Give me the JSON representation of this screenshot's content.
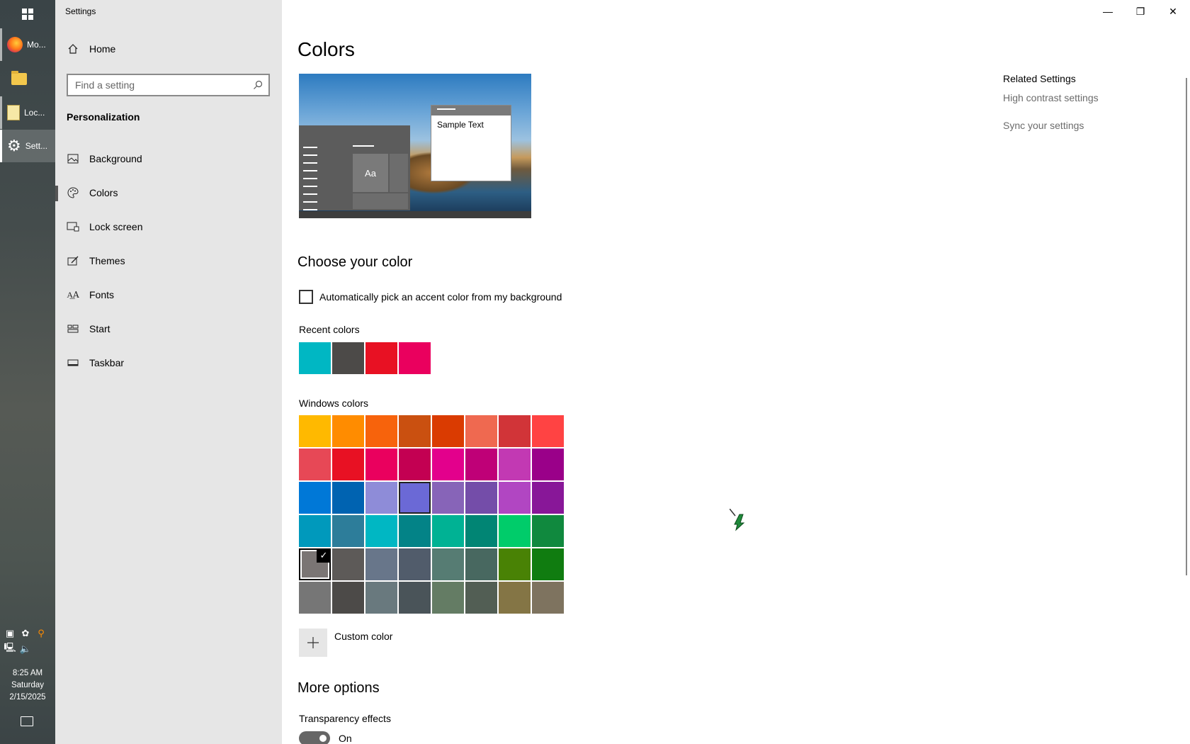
{
  "window": {
    "title": "Settings",
    "controls": {
      "minimize": "—",
      "restore": "❐",
      "close": "✕"
    }
  },
  "taskbar": {
    "apps": [
      {
        "label": "Mo...",
        "icon": "firefox-icon"
      },
      {
        "label": "",
        "icon": "file-explorer-icon"
      },
      {
        "label": "Loc...",
        "icon": "notepad-icon"
      },
      {
        "label": "Sett...",
        "icon": "gear-icon"
      }
    ],
    "clock": {
      "time": "8:25 AM",
      "day": "Saturday",
      "date": "2/15/2025"
    }
  },
  "nav": {
    "home_label": "Home",
    "search_placeholder": "Find a setting",
    "section_title": "Personalization",
    "items": [
      {
        "label": "Background",
        "icon": "background-icon"
      },
      {
        "label": "Colors",
        "icon": "palette-icon"
      },
      {
        "label": "Lock screen",
        "icon": "lock-screen-icon"
      },
      {
        "label": "Themes",
        "icon": "themes-icon"
      },
      {
        "label": "Fonts",
        "icon": "fonts-icon"
      },
      {
        "label": "Start",
        "icon": "start-icon"
      },
      {
        "label": "Taskbar",
        "icon": "taskbar-icon"
      }
    ],
    "selected_item": "Colors"
  },
  "main": {
    "title": "Colors",
    "preview": {
      "sample_text": "Sample Text",
      "tile_text": "Aa"
    },
    "choose_color_heading": "Choose your color",
    "auto_pick_label": "Automatically pick an accent color from my background",
    "auto_pick_checked": false,
    "recent_colors_label": "Recent colors",
    "recent_colors": [
      "#00b7c3",
      "#4c4a48",
      "#e81123",
      "#ea005e"
    ],
    "windows_colors_label": "Windows colors",
    "windows_colors": [
      [
        "#ffb900",
        "#ff8c00",
        "#f7630c",
        "#ca5010",
        "#da3b01",
        "#ef6950",
        "#d13438",
        "#ff4343"
      ],
      [
        "#e74856",
        "#e81123",
        "#ea005e",
        "#c30052",
        "#e3008c",
        "#bf0077",
        "#c239b3",
        "#9a0089"
      ],
      [
        "#0078d7",
        "#0063b1",
        "#8e8cd8",
        "#6b69d6",
        "#8764b8",
        "#744da9",
        "#b146c2",
        "#881798"
      ],
      [
        "#0099bc",
        "#2d7d9a",
        "#00b7c3",
        "#038387",
        "#00b294",
        "#018574",
        "#00cc6a",
        "#10893e"
      ],
      [
        "#7a7574",
        "#5d5a58",
        "#68768a",
        "#515c6b",
        "#567c73",
        "#486860",
        "#498205",
        "#107c10"
      ],
      [
        "#767676",
        "#4c4a48",
        "#69797e",
        "#4a5459",
        "#647c64",
        "#525e54",
        "#847545",
        "#7e735f"
      ]
    ],
    "selected_color": "#7a7574",
    "hovered_color": "#6b69d6",
    "custom_color_label": "Custom color",
    "more_options_heading": "More options",
    "transparency_label": "Transparency effects",
    "transparency_state": "On",
    "transparency_on": true
  },
  "related": {
    "title": "Related Settings",
    "links": [
      "High contrast settings",
      "Sync your settings"
    ]
  }
}
